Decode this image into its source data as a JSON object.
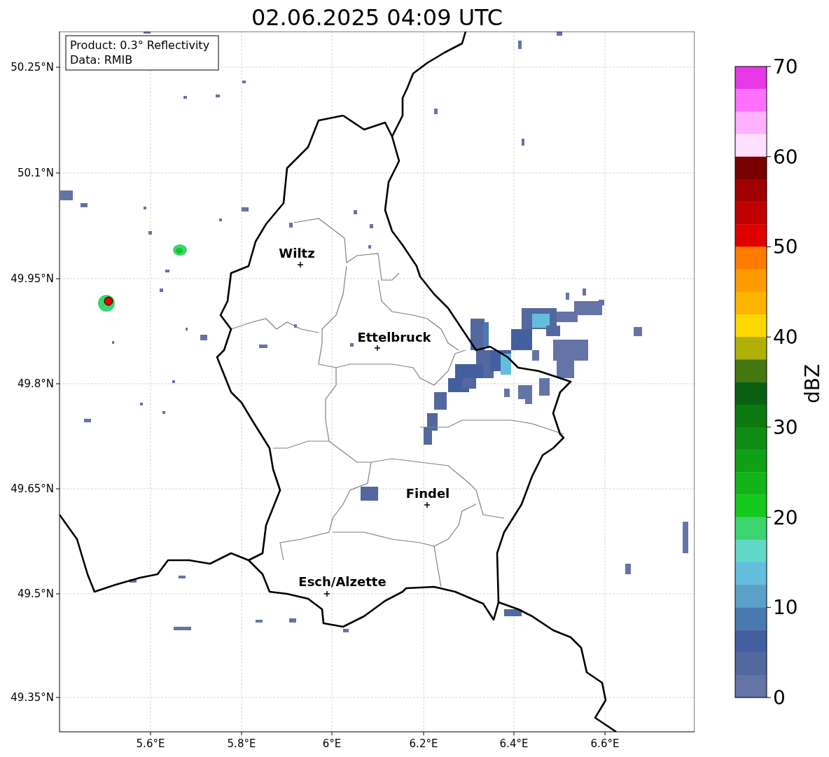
{
  "title": "02.06.2025 04:09 UTC",
  "info_box": [
    "Product: 0.3° Reflectivity",
    "Data: RMIB"
  ],
  "lat_ticks": [
    "50.25°N",
    "50.1°N",
    "49.95°N",
    "49.8°N",
    "49.65°N",
    "49.5°N",
    "49.35°N"
  ],
  "lon_ticks": [
    "5.6°E",
    "5.8°E",
    "6°E",
    "6.2°E",
    "6.4°E",
    "6.6°E"
  ],
  "cities": [
    {
      "name": "Wiltz"
    },
    {
      "name": "Ettelbruck"
    },
    {
      "name": "Findel"
    },
    {
      "name": "Esch/Alzette"
    }
  ],
  "colorbar": {
    "label": "dBZ",
    "ticks": [
      "70",
      "60",
      "50",
      "40",
      "30",
      "20",
      "10",
      "0"
    ],
    "bands": [
      {
        "color": "#e838e8"
      },
      {
        "color": "#ff70ff"
      },
      {
        "color": "#ffb0ff"
      },
      {
        "color": "#ffe0ff"
      },
      {
        "color": "#780000"
      },
      {
        "color": "#a00000"
      },
      {
        "color": "#c00000"
      },
      {
        "color": "#e00000"
      },
      {
        "color": "#ff7c00"
      },
      {
        "color": "#ff9a00"
      },
      {
        "color": "#ffb400"
      },
      {
        "color": "#ffd700"
      },
      {
        "color": "#b0b008"
      },
      {
        "color": "#457810"
      },
      {
        "color": "#0a6010"
      },
      {
        "color": "#0c7810"
      },
      {
        "color": "#0e8c14"
      },
      {
        "color": "#10a016"
      },
      {
        "color": "#12b41a"
      },
      {
        "color": "#14c81e"
      },
      {
        "color": "#3cd46e"
      },
      {
        "color": "#62d8c8"
      },
      {
        "color": "#62bedc"
      },
      {
        "color": "#5aa0c8"
      },
      {
        "color": "#4a7ab0"
      },
      {
        "color": "#445fa0"
      },
      {
        "color": "#52689e"
      },
      {
        "color": "#6574a6"
      }
    ]
  }
}
